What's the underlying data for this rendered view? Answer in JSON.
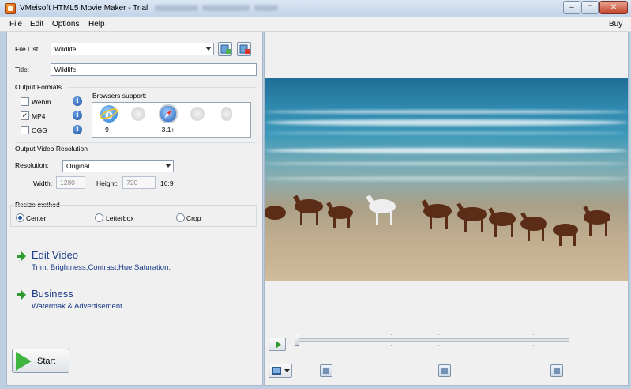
{
  "window": {
    "title": "VMeisoft HTML5 Movie Maker - Trial",
    "controls": {
      "minimize": "–",
      "maximize": "□",
      "close": "✕"
    }
  },
  "menu": {
    "items": [
      {
        "label": "File"
      },
      {
        "label": "Edit"
      },
      {
        "label": "Options"
      },
      {
        "label": "Help"
      }
    ],
    "buy_label": "Buy"
  },
  "file_list": {
    "label": "File List:",
    "selected": "Wildlife"
  },
  "title_field": {
    "label": "Title:",
    "value": "Wildlife"
  },
  "output_formats": {
    "heading": "Output Formats",
    "formats": [
      {
        "name": "Webm",
        "checked": false
      },
      {
        "name": "MP4",
        "checked": true
      },
      {
        "name": "OGG",
        "checked": false
      }
    ],
    "info_icon": "info-icon"
  },
  "browsers": {
    "heading": "Browsers support:",
    "items": [
      {
        "name": "ie-icon",
        "version": "9+",
        "active": true
      },
      {
        "name": "firefox-icon",
        "version": "",
        "active": false
      },
      {
        "name": "safari-icon",
        "version": "3.1+",
        "active": true
      },
      {
        "name": "chrome-icon",
        "version": "",
        "active": false
      },
      {
        "name": "opera-icon",
        "version": "",
        "active": false
      }
    ]
  },
  "resolution": {
    "heading": "Output Video Resolution",
    "label": "Resolution:",
    "selected": "Original",
    "width_label": "Width:",
    "width_value": "1280",
    "height_label": "Height:",
    "height_value": "720",
    "aspect": "16:9"
  },
  "resize": {
    "heading": "Resize method",
    "options": [
      {
        "label": "Center",
        "selected": true
      },
      {
        "label": "Letterbox",
        "selected": false
      },
      {
        "label": "Crop",
        "selected": false
      }
    ]
  },
  "actions": [
    {
      "title": "Edit Video",
      "subtitle": "Trim, Brightness,Contrast,Hue,Saturation."
    },
    {
      "title": "Business",
      "subtitle": "Watermak & Advertisement"
    }
  ],
  "start_label": "Start",
  "player": {
    "progress": 0
  },
  "colors": {
    "accent_text": "#1a3a88",
    "start_green": "#3fb43f"
  }
}
